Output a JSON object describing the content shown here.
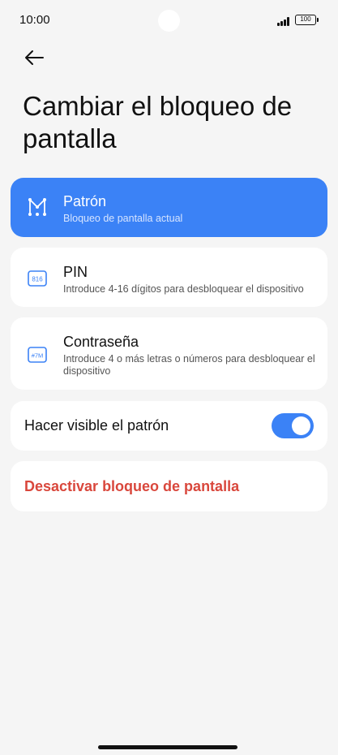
{
  "status": {
    "time": "10:00",
    "battery": "100"
  },
  "header": {
    "title": "Cambiar el bloqueo de pantalla"
  },
  "options": [
    {
      "label": "Patrón",
      "sub": "Bloqueo de pantalla actual",
      "selected": true
    },
    {
      "label": "PIN",
      "sub": "Introduce 4-16 dígitos para desbloquear el dispositivo",
      "icon_text": "816"
    },
    {
      "label": "Contraseña",
      "sub": "Introduce 4 o más letras o números para desbloquear el dispositivo",
      "icon_text": "#7M"
    }
  ],
  "visible_pattern": {
    "label": "Hacer visible el patrón",
    "enabled": true
  },
  "disable": {
    "label": "Desactivar bloqueo de pantalla"
  },
  "colors": {
    "accent": "#3b82f6",
    "danger": "#d9473c",
    "background": "#f5f5f5"
  }
}
